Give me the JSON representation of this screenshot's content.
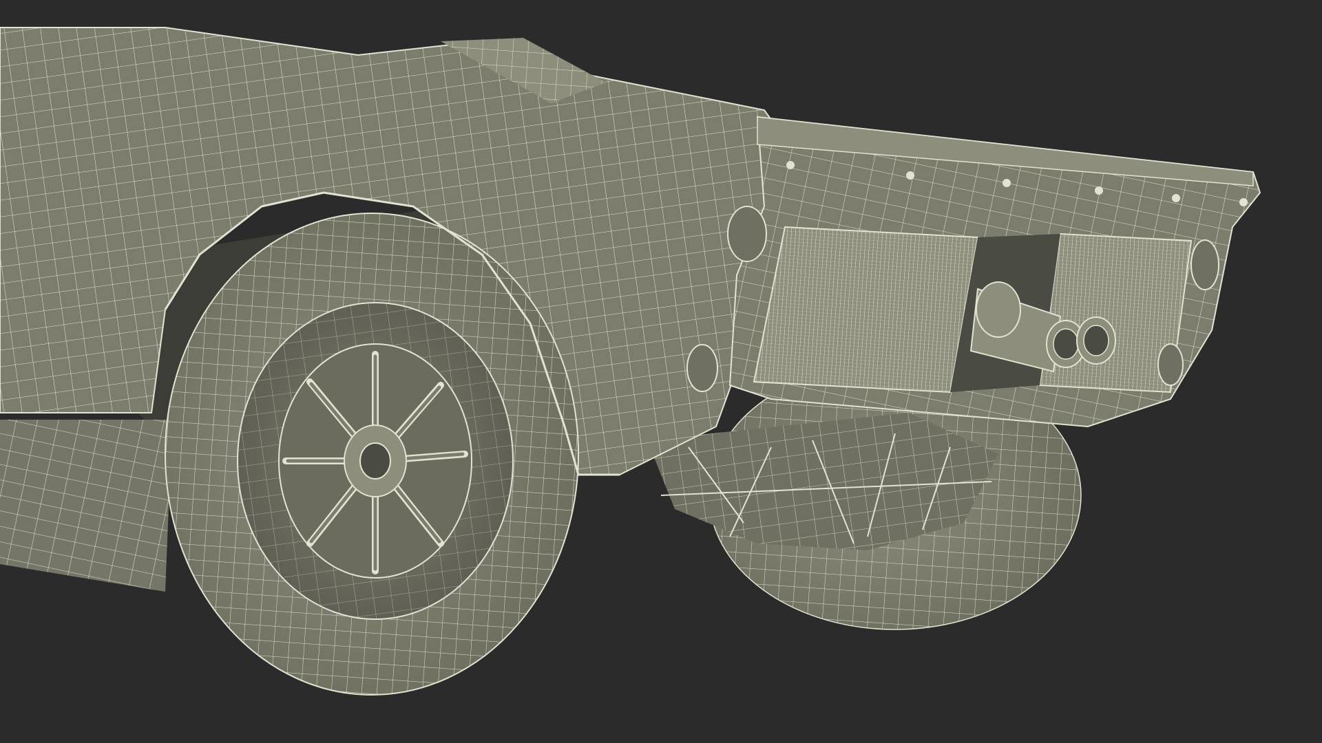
{
  "scene": {
    "subject": "wireframe-render-rear-of-race-car",
    "colors": {
      "background": "#2b2b2b",
      "body_fill": "#7c7d6c",
      "body_fill_dark": "#5f6054",
      "body_fill_light": "#8d8e7c",
      "shadow": "#3c3d36",
      "wire": "#e2e3d2",
      "wire_dim": "#c9cab7"
    },
    "icons": {
      "wheel_left": "rear-wheel",
      "wheel_right": "rear-wheel",
      "exhaust": "twin-exhaust-pipes"
    }
  }
}
